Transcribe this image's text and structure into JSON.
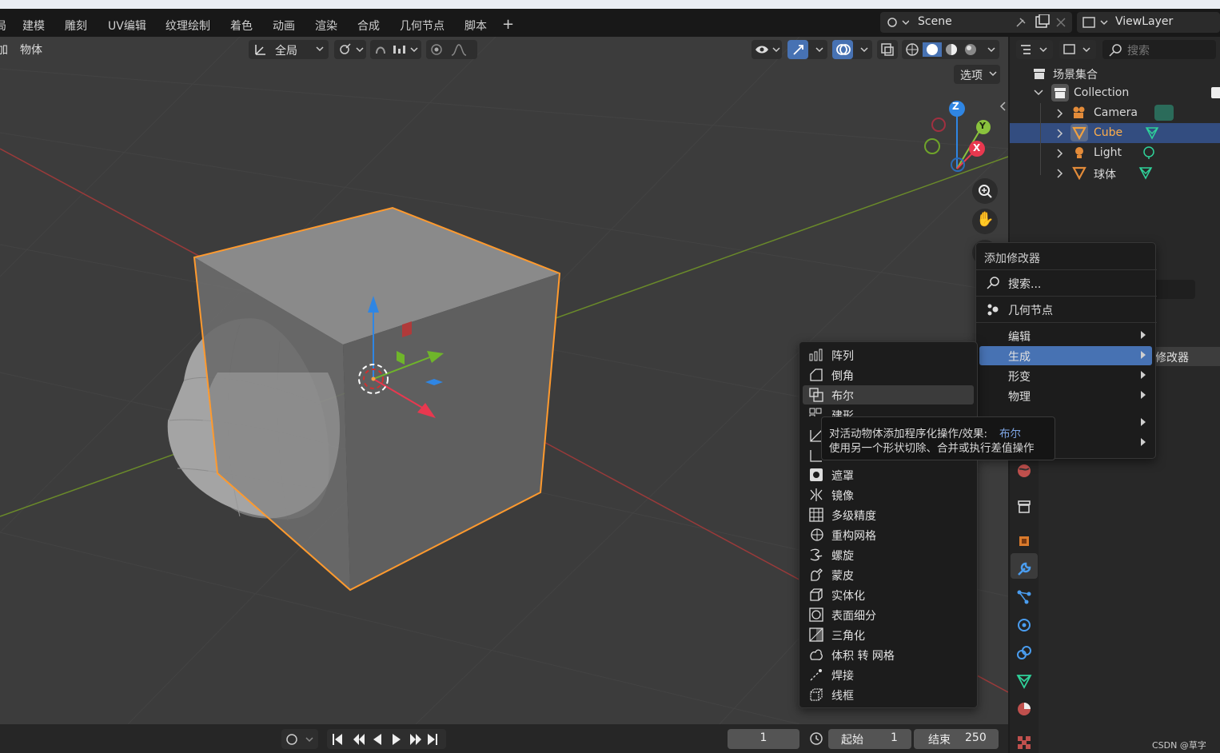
{
  "workspace_tabs": [
    "建模",
    "雕刻",
    "UV编辑",
    "纹理绘制",
    "着色",
    "动画",
    "渲染",
    "合成",
    "几何节点",
    "脚本"
  ],
  "partial_tab": "局",
  "scene_label": "Scene",
  "viewlayer_label": "ViewLayer",
  "header": {
    "partial_menu": "加",
    "object_menu": "物体",
    "orientation": "全局",
    "options": "选项"
  },
  "outliner": {
    "search_placeholder": "搜索",
    "scene_collection": "场景集合",
    "collection": "Collection",
    "items": [
      {
        "name": "Camera",
        "color": "#e38b39"
      },
      {
        "name": "Cube",
        "color": "#e38b39",
        "selected": true
      },
      {
        "name": "Light",
        "color": "#e38b39"
      },
      {
        "name": "球体",
        "color": "#e38b39"
      }
    ]
  },
  "gizmo": {
    "z": "Z",
    "y": "Y",
    "x": "X"
  },
  "add_modifier_menu": {
    "title": "添加修改器",
    "search": "搜索...",
    "geometry_nodes": "几何节点",
    "categories": [
      "编辑",
      "生成",
      "形变",
      "物理"
    ],
    "active_category": "生成"
  },
  "generate_submenu": {
    "items": [
      "阵列",
      "倒角",
      "布尔",
      "建形",
      "",
      "",
      "遮罩",
      "镜像",
      "多级精度",
      "重构网格",
      "螺旋",
      "蒙皮",
      "实体化",
      "表面细分",
      "三角化",
      "体积 转 网格",
      "焊接",
      "线框"
    ],
    "highlighted": "布尔"
  },
  "tooltip": {
    "line1_prefix": "对活动物体添加程序化操作/效果:",
    "line1_name": "布尔",
    "line2": "使用另一个形状切除、合并或执行差值操作"
  },
  "props_partial": "修改器",
  "timeline": {
    "current_frame": "1",
    "start_label": "起始",
    "start_value": "1",
    "end_label": "结束",
    "end_value": "250"
  },
  "watermark": "CSDN @草字",
  "colors": {
    "accent": "#4772b3",
    "selection_orange": "#ff9a2e",
    "x_axis": "#e8384f",
    "y_axis": "#8ac33d",
    "z_axis": "#2f86e4"
  }
}
